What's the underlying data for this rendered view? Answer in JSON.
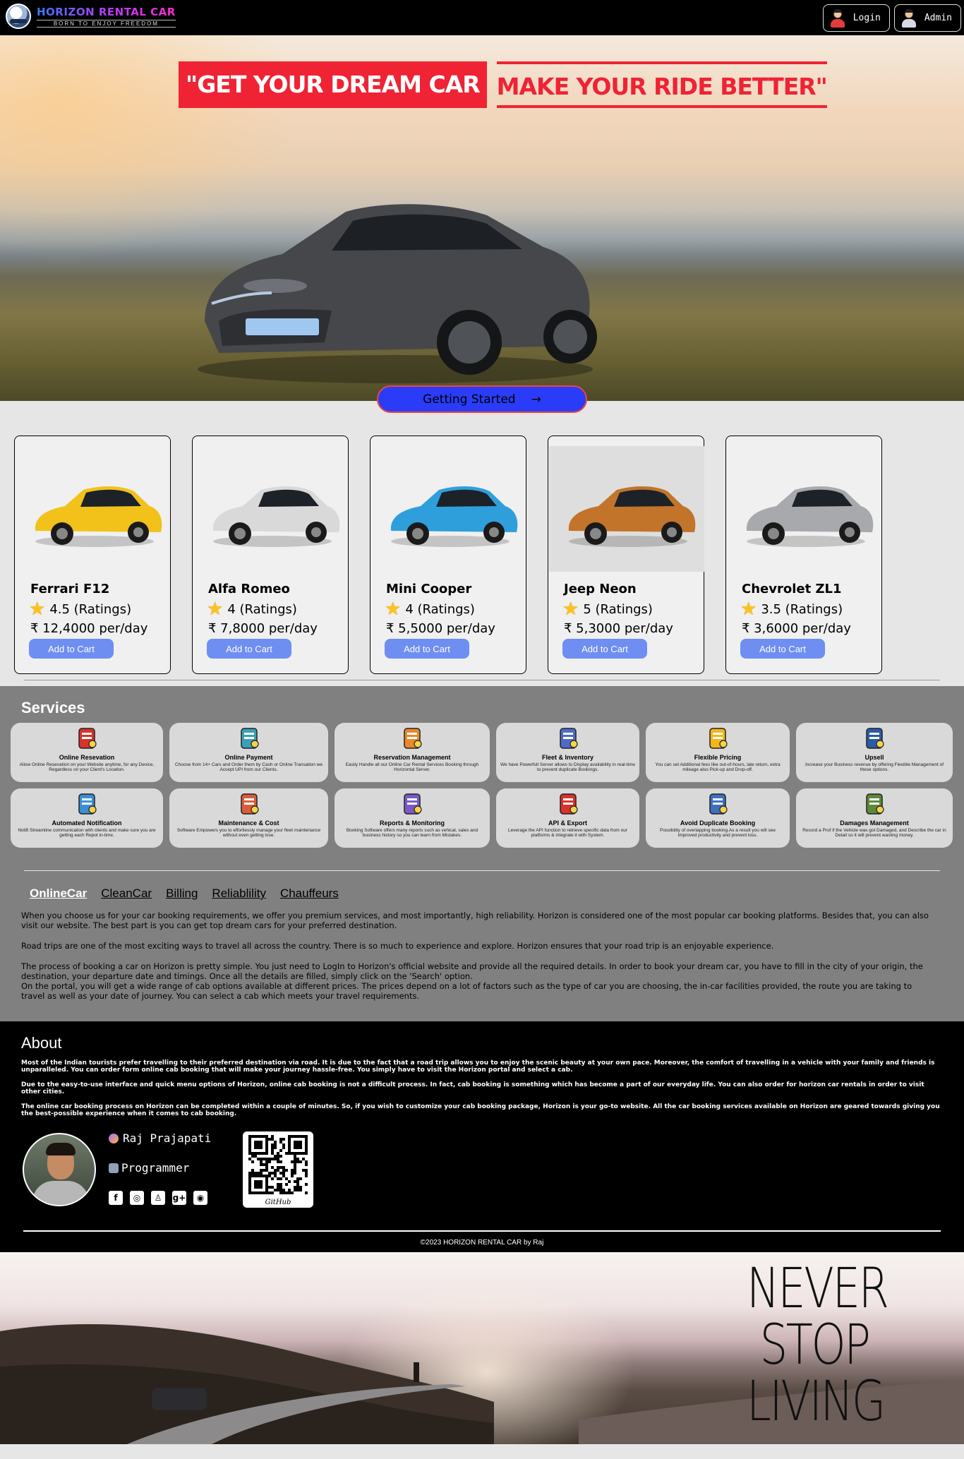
{
  "header": {
    "brand_name": "HORIZON RENTAL CAR",
    "brand_tagline": "BORN TO ENJOY FREEDOM",
    "login_label": "Login",
    "admin_label": "Admin"
  },
  "hero": {
    "headline_left": "\"GET YOUR DREAM CAR",
    "headline_right": "MAKE YOUR RIDE BETTER\"",
    "cta_label": "Getting Started",
    "cta_arrow": "→"
  },
  "cars": [
    {
      "name": "Ferrari F12",
      "rating": "4.5 (Ratings)",
      "price": "₹ 12,4000 per/day",
      "button": "Add to Cart",
      "color": "#f2c21b"
    },
    {
      "name": "Alfa Romeo",
      "rating": "4 (Ratings)",
      "price": "₹ 7,8000 per/day",
      "button": "Add to Cart",
      "color": "#d9d9d9"
    },
    {
      "name": "Mini Cooper",
      "rating": "4 (Ratings)",
      "price": "₹ 5,5000 per/day",
      "button": "Add to Cart",
      "color": "#2f9fdc"
    },
    {
      "name": "Jeep Neon",
      "rating": "5 (Ratings)",
      "price": "₹ 5,3000 per/day",
      "button": "Add to Cart",
      "color": "#c2742a"
    },
    {
      "name": "Chevrolet ZL1",
      "rating": "3.5 (Ratings)",
      "price": "₹ 3,6000 per/day",
      "button": "Add to Cart",
      "color": "#a7a9ad"
    }
  ],
  "services": {
    "title": "Services",
    "items": [
      {
        "title": "Online Resevation",
        "desc": "Allow Online Resevation on your Website anytime, for any Device, Regardless on your Client's Location."
      },
      {
        "title": "Online Payment",
        "desc": "Choose from 14+ Cars and Order them by Cash or Online Transation we Accept UPI from our Clients."
      },
      {
        "title": "Reservation Management",
        "desc": "Easily Handle all our Online Car Rental Services Booking through Horizontal Server."
      },
      {
        "title": "Fleet & Inventory",
        "desc": "We have Powerfull Server allows to Display availability in real-time to prevent duplicate Bookings."
      },
      {
        "title": "Flexible Pricing",
        "desc": "You can set Additional fees like out-of-hours, late return, extra mileage also Pick-up and Drop-off."
      },
      {
        "title": "Upsell",
        "desc": "Increase your Business revenue by offering Flexible Management of these options."
      },
      {
        "title": "Automated Notification",
        "desc": "Notifi Streamline communication with clients and make sure you are getting each Repot in-time."
      },
      {
        "title": "Maintenance & Cost",
        "desc": "Software Empowers you to effortlessly manage your fleet maintenance without even getting lose."
      },
      {
        "title": "Reports & Monitoring",
        "desc": "Booking Software offers many reports such as vehical, sales and business history so you can learn from Mistakes."
      },
      {
        "title": "API & Export",
        "desc": "Leverage the API function to retrieve specific data from our platforms & integrate it with System."
      },
      {
        "title": "Avoid Duplicate Booking",
        "desc": "Possibility of overlapping booking.As a result you will see improved productivity and prevent loss."
      },
      {
        "title": "Damages Management",
        "desc": "Record a Prof if the Vehicle was got Damaged, and Describe the car in Detail so it will prevent wasting money."
      }
    ]
  },
  "tabs": [
    "OnlineCar",
    "CleanCar",
    "Billing",
    "Reliablility",
    "Chauffeurs"
  ],
  "tab_content": {
    "p1": "When you choose us for your car booking requirements, we offer you premium services, and most importantly, high reliability. Horizon is considered one of the most popular car booking platforms. Besides that, you can also visit our website. The best part is you can get top dream cars for your preferred destination.",
    "p2": "Road trips are one of the most exciting ways to travel all across the country. There is so much to experience and explore. Horizon ensures that your road trip is an enjoyable experience.",
    "p3": "The process of booking a car on Horizon is pretty simple. You just need to LogIn to Horizon's official website and provide all the required details. In order to book your dream car, you have to fill in the city of your origin, the destination, your departure date and timings. Once all the details are filled, simply click on the 'Search' option.",
    "p4": "On the portal, you will get a wide range of cab options available at different prices. The prices depend on a lot of factors such as the type of car you are choosing, the in-car facilities provided, the route you are taking to travel as well as your date of journey. You can select a cab which meets your travel requirements."
  },
  "about": {
    "title": "About",
    "p1": "Most of the Indian tourists prefer travelling to their preferred destination via road. It is due to the fact that a road trip allows you to enjoy the scenic beauty at your own pace. Moreover, the comfort of travelling in a vehicle with your family and friends is unparalleled. You can order form online cab booking that will make your journey hassle-free. You simply have to visit the Horizon portal and select a cab.",
    "p2": "Due to the easy-to-use interface and quick menu options of Horizon, online cab booking is not a difficult process. In fact, cab booking is something which has become a part of our everyday life. You can also order for horizon car rentals in order to visit other cities.",
    "p3": "The online car booking process on Horizon can be completed within a couple of minutes. So, if you wish to customize your cab booking package, Horizon is your go-to website. All the car booking services available on Horizon are geared towards giving you the best-possible experience when it comes to cab booking."
  },
  "profile": {
    "name": "Raj Prajapati",
    "role": "Programmer",
    "socials": [
      "facebook-icon",
      "instagram-icon",
      "snapchat-icon",
      "google-plus-icon",
      "github-icon"
    ],
    "qr_label": "GitHub"
  },
  "footer": {
    "copyright": "©2023 HORIZON RENTAL CAR by Raj"
  },
  "banner": {
    "line1": "NEVER",
    "line2": "STOP",
    "line3": "LIVING"
  },
  "colors": {
    "accent_blue": "#2a3cf7",
    "brand_red": "#ef2334",
    "button_blue": "#6e8ef2",
    "services_bg": "#808080"
  }
}
